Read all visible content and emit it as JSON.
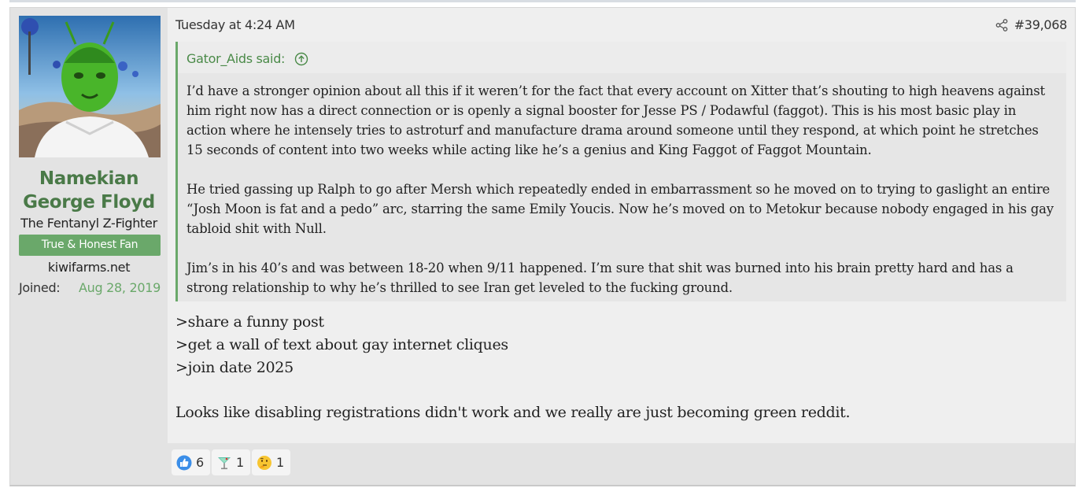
{
  "user": {
    "name_line1": "Namekian",
    "name_line2": "George Floyd",
    "title": "The Fentanyl Z-Fighter",
    "banner": "True & Honest Fan",
    "site": "kiwifarms.net",
    "joined_label": "Joined:",
    "joined_date": "Aug 28, 2019"
  },
  "post": {
    "date": "Tuesday at 4:24 AM",
    "number": "#39,068",
    "share_icon": "share-icon",
    "quote": {
      "author": "Gator_Aids said:",
      "jump_icon": "arrow-up-circle-icon",
      "paragraphs": [
        "I’d have a stronger opinion about all this if it weren’t for the fact that every account on Xitter that’s shouting to high heavens against him right now has a direct connection or is openly a signal booster for Jesse PS / Podawful (faggot). This is his most basic play in action where he intensely tries to astroturf and manufacture drama around someone until they respond, at which point he stretches 15 seconds of content into two weeks while acting like he’s a genius and King Faggot of Faggot Mountain.",
        "He tried gassing up Ralph to go after Mersh which repeatedly ended in embarrassment so he moved on to trying to gaslight an entire “Josh Moon is fat and a pedo” arc, starring the same Emily Youcis. Now he’s moved on to Metokur because nobody engaged in his gay tabloid shit with Null.",
        "Jim’s in his 40’s and was between 18-20 when 9/11 happened. I’m sure that shit was burned into his brain pretty hard and has a strong relationship to why he’s thrilled to see Iran get leveled to the fucking ground."
      ]
    },
    "body_lines": [
      ">share a funny post",
      ">get a wall of text about gay internet cliques",
      ">join date 2025"
    ],
    "body_closing": "Looks like disabling registrations didn't work and we really are just becoming green reddit."
  },
  "reactions": [
    {
      "icon": "thumbs-up-icon",
      "count": "6"
    },
    {
      "icon": "cocktail-icon",
      "count": "1"
    },
    {
      "icon": "thinking-face-icon",
      "count": "1"
    }
  ],
  "colors": {
    "accent_green": "#6aa86a",
    "username_green": "#4a7a48"
  }
}
